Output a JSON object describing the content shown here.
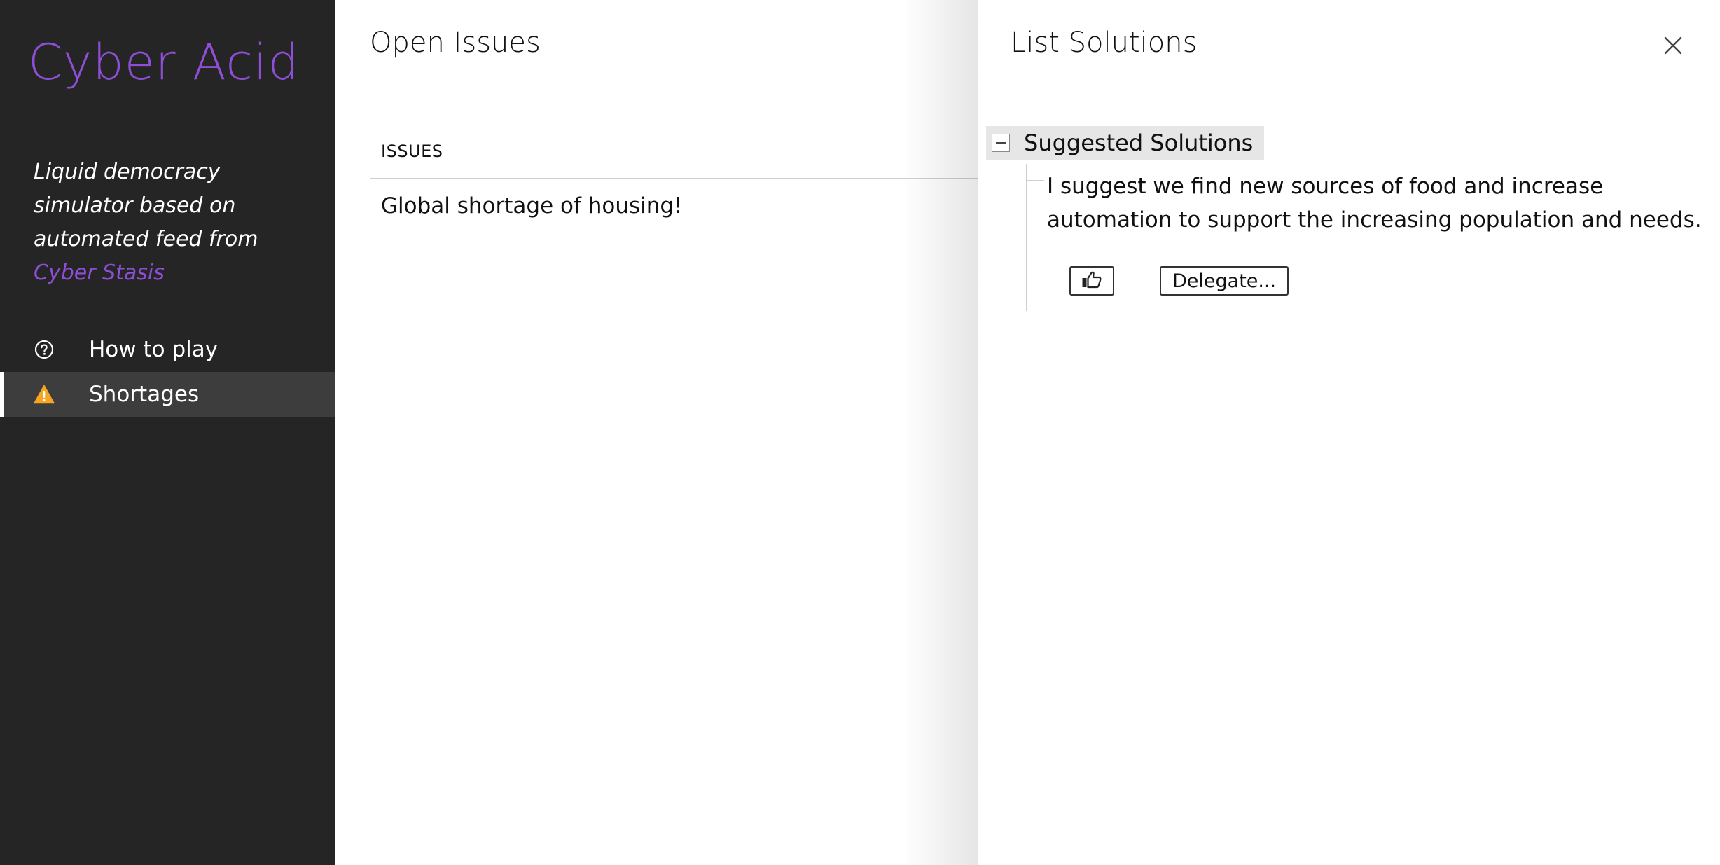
{
  "sidebar": {
    "brand": "Cyber Acid",
    "tagline_prefix": "Liquid democracy simulator based on automated feed from ",
    "tagline_link": "Cyber Stasis",
    "items": [
      {
        "label": "How to play",
        "icon": "help-circle-icon",
        "active": false
      },
      {
        "label": "Shortages",
        "icon": "warning-icon",
        "active": true
      }
    ]
  },
  "main": {
    "title": "Open Issues",
    "table": {
      "header": "ISSUES",
      "rows": [
        "Global shortage of housing!"
      ]
    }
  },
  "drawer": {
    "title": "List Solutions",
    "close_icon": "close-icon",
    "tree": {
      "node_label": "Suggested Solutions",
      "toggle_icon": "collapse-minus-icon",
      "solution": {
        "text": "I suggest we find new sources of food and increase automation to support the increasing population and needs.",
        "vote_icon": "thumbs-up-icon",
        "delegate_label": "Delegate..."
      }
    }
  },
  "colors": {
    "sidebar_bg": "#252525",
    "brand_purple": "#8e4fd6",
    "warning_orange": "#f5a623",
    "active_item_bg": "#3d3d3d"
  }
}
